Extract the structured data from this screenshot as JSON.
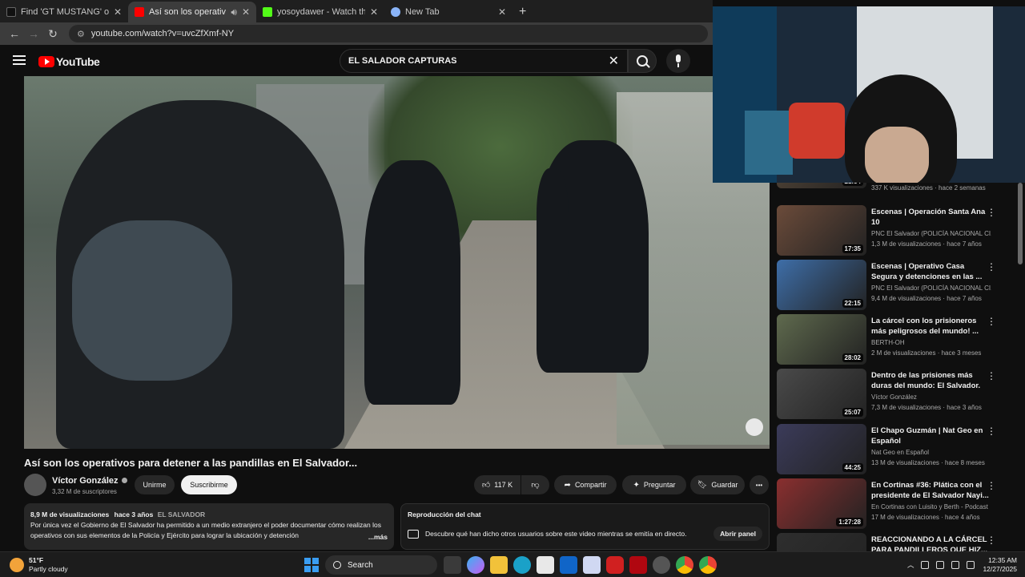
{
  "browser": {
    "tabs": [
      {
        "title": "Find 'GT MUSTANG' on TikTok |",
        "color": "#111111"
      },
      {
        "title": "Así son los operativos para",
        "color": "#ff0000",
        "active": true
      },
      {
        "title": "yosoydawer - Watch the VOD o",
        "color": "#53fc18"
      },
      {
        "title": "New Tab",
        "color": "#8ab4f8"
      }
    ],
    "new_tab": "+",
    "url": "youtube.com/watch?v=uvcZfXmf-NY"
  },
  "youtube": {
    "logo": "YouTube",
    "search_query": "EL SALADOR CAPTURAS",
    "video": {
      "title": "Así son los operativos para detener a las pandillas en El Salvador...",
      "channel": "Víctor González",
      "subscribers": "3,32 M de suscriptores",
      "join_label": "Unirme",
      "subscribe_label": "Suscribirme",
      "likes": "117 K",
      "share_label": "Compartir",
      "ask_label": "Preguntar",
      "save_label": "Guardar",
      "more_label": "•••",
      "views": "8,9 M de visualizaciones",
      "age": "hace 3 años",
      "tag": "EL SALVADOR",
      "description": "Por única vez el Gobierno de El Salvador ha permitido a un medio extranjero el poder documentar cómo realizan los operativos con sus elementos de la Policía y Ejército para lograr la ubicación y detención",
      "more": "...más"
    },
    "chat": {
      "title": "Reproducción del chat",
      "text": "Descubre qué han dicho otros usuarios sobre este video mientras se emitía en directo.",
      "open_label": "Abrir panel"
    },
    "recommendations": [
      {
        "title": "",
        "channel": "",
        "views": "337 K visualizaciones · hace 2 semanas",
        "duration": "21:54",
        "color": "#5a4a3a"
      },
      {
        "title": "Escenas | Operación Santa Ana 10",
        "channel": "PNC El Salvador (POLICÍA NACIONAL CI...",
        "views": "1,3 M de visualizaciones · hace 7 años",
        "duration": "17:35",
        "color": "#6b4b3a"
      },
      {
        "title": "Escenas | Operativo Casa Segura  y detenciones en las ...",
        "channel": "PNC El Salvador (POLICÍA NACIONAL CI...",
        "views": "9,4 M de visualizaciones · hace 7 años",
        "duration": "22:15",
        "color": "#3e6ea8"
      },
      {
        "title": "La cárcel con los prisioneros más peligrosos del mundo! ...",
        "channel": "BERTH-OH",
        "views": "2 M de visualizaciones · hace 3 meses",
        "duration": "28:02",
        "color": "#5f6a4e"
      },
      {
        "title": "Dentro de las prisiones más duras del mundo: El Salvador.",
        "channel": "Víctor González",
        "views": "7,3 M de visualizaciones · hace 3 años",
        "duration": "25:07",
        "color": "#4a4a4a"
      },
      {
        "title": "El Chapo Guzmán | Nat Geo en Español",
        "channel": "Nat Geo en Español",
        "views": "13 M de visualizaciones · hace 8 meses",
        "duration": "44:25",
        "color": "#3b3b5a"
      },
      {
        "title": "En Cortinas #36: Plática con el presidente de El Salvador Nayi...",
        "channel": "En Cortinas con Luisito y Berth - Podcast",
        "views": "17 M de visualizaciones · hace 4 años",
        "duration": "1:27:28",
        "color": "#8a2f2f"
      },
      {
        "title": "REACCIONANDO A LA CÁRCEL PARA PANDILLEROS QUE HIZ...",
        "channel": "",
        "views": "",
        "duration": "",
        "color": "#2e2e2e"
      }
    ]
  },
  "taskbar": {
    "temperature": "51°F",
    "condition": "Partly cloudy",
    "search_label": "Search",
    "time": "12:35 AM",
    "date": "12/27/2025"
  }
}
